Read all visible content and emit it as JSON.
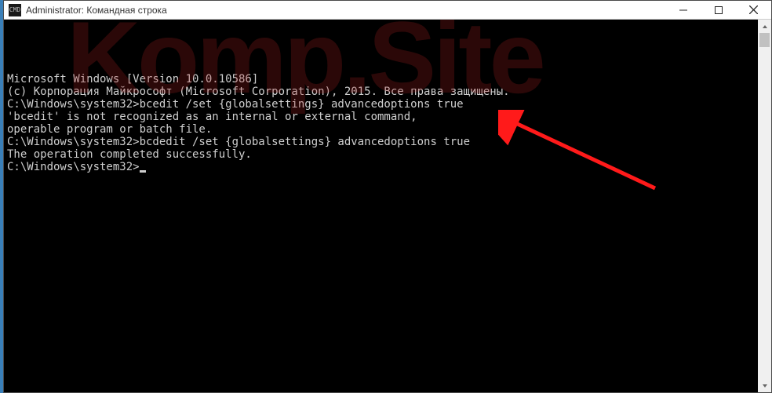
{
  "titlebar": {
    "icon_label": "CMD",
    "title": "Administrator: Командная строка"
  },
  "console": {
    "lines": [
      "Microsoft Windows [Version 10.0.10586]",
      "(c) Корпорация Майкрософт (Microsoft Corporation), 2015. Все права защищены.",
      "",
      "C:\\Windows\\system32>bcedit /set {globalsettings} advancedoptions true",
      "'bcedit' is not recognized as an internal or external command,",
      "operable program or batch file.",
      "",
      "C:\\Windows\\system32>bcdedit /set {globalsettings} advancedoptions true",
      "The operation completed successfully.",
      ""
    ],
    "prompt": "C:\\Windows\\system32>"
  },
  "watermark": "Komp.Site",
  "arrow": {
    "color": "#ff1a1a"
  }
}
